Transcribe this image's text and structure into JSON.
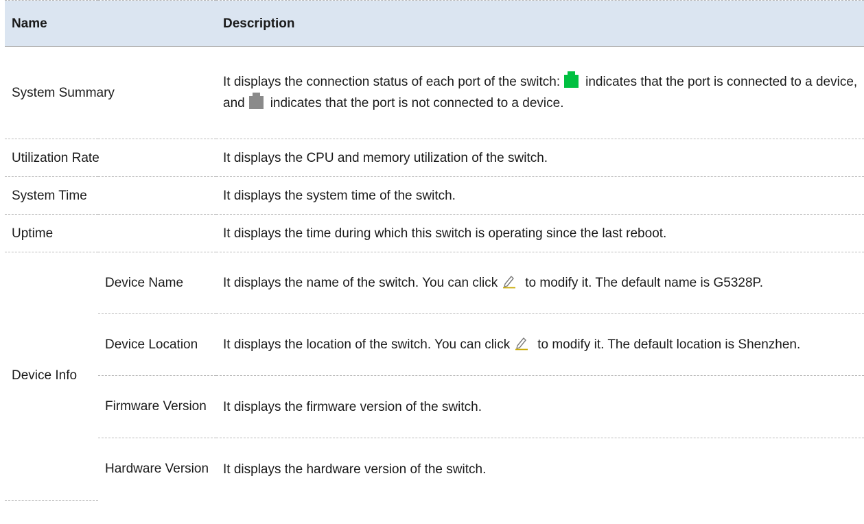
{
  "header": {
    "name": "Name",
    "description": "Description"
  },
  "rows": {
    "system_summary": {
      "name": "System Summary",
      "desc_part1": "It displays the connection status of each port of the switch:",
      "desc_part2": "indicates that the port is connected to a device, and",
      "desc_part3": "indicates that the port is not connected to a device."
    },
    "utilization_rate": {
      "name": "Utilization Rate",
      "desc": "It displays the CPU and memory utilization of the switch."
    },
    "system_time": {
      "name": "System Time",
      "desc": "It displays the system time of the switch."
    },
    "uptime": {
      "name": "Uptime",
      "desc": "It displays the time during which this switch is operating since the last reboot."
    },
    "device_info": {
      "group": "Device Info",
      "device_name": {
        "name": "Device Name",
        "desc_part1": "It displays the name of the switch. You can click",
        "desc_part2": "to modify it. The default name is G5328P."
      },
      "device_location": {
        "name": "Device Location",
        "desc_part1": "It displays the location of the switch. You can click",
        "desc_part2": "to modify it. The default location is Shenzhen."
      },
      "firmware_version": {
        "name": "Firmware Version",
        "desc": "It displays the firmware version of the switch."
      },
      "hardware_version": {
        "name": "Hardware Version",
        "desc": "It displays the hardware version of the switch."
      }
    }
  },
  "icons": {
    "port_connected": {
      "name": "port-connected-icon",
      "color": "#00c040"
    },
    "port_disconnected": {
      "name": "port-disconnected-icon",
      "color": "#8a8a8a"
    },
    "edit": {
      "name": "edit-pencil-icon",
      "color": "#7a7a7a",
      "underline": "#c8a800"
    }
  }
}
